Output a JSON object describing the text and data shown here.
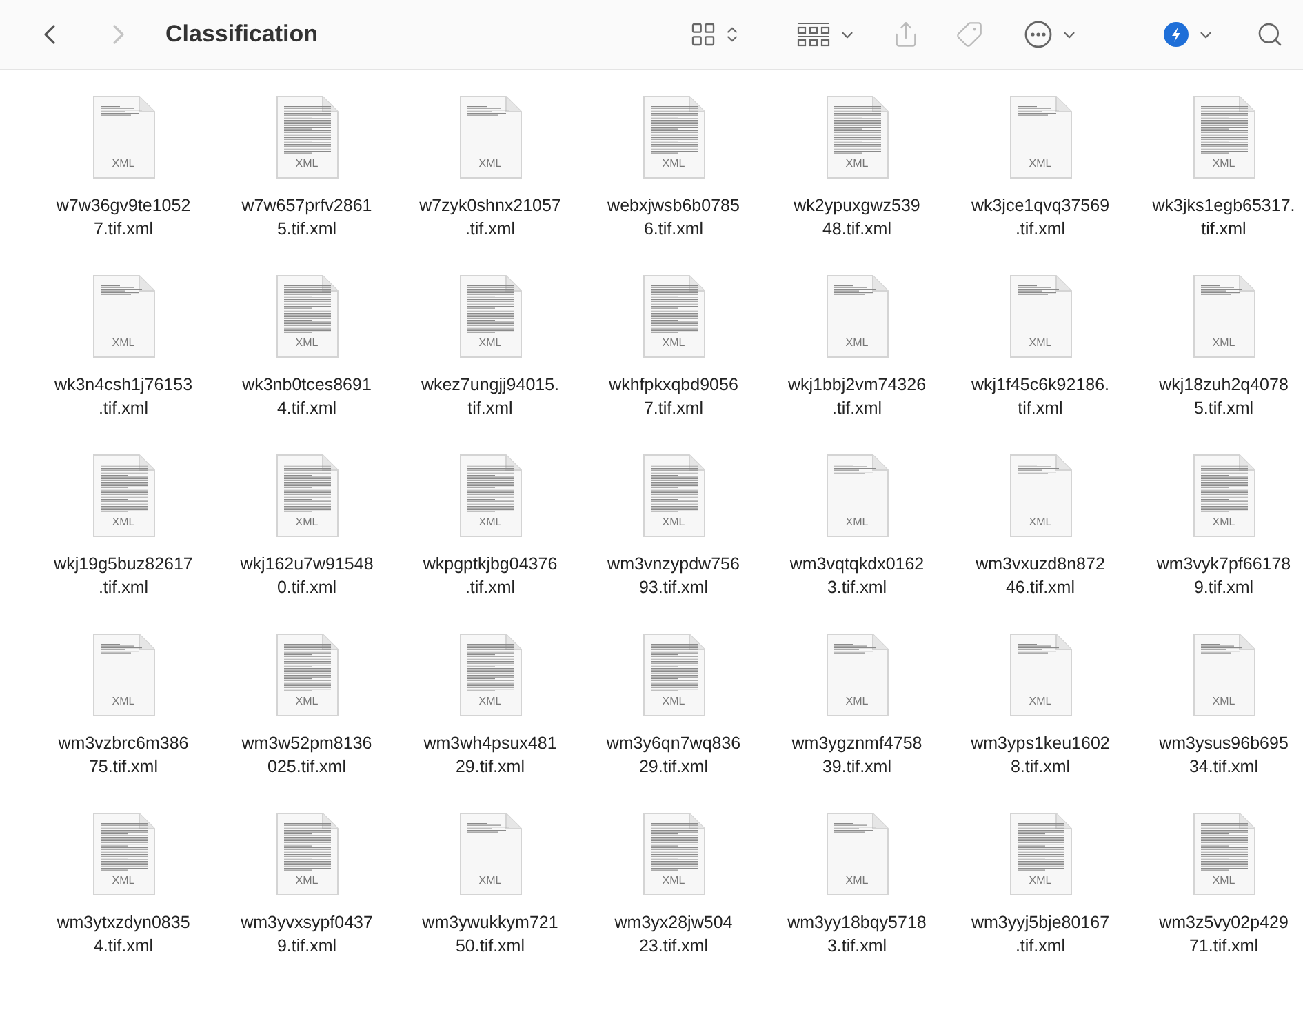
{
  "toolbar": {
    "title": "Classification",
    "navigation": [
      {
        "kind": "back",
        "disabled": false
      },
      {
        "kind": "forward",
        "disabled": true
      }
    ]
  },
  "files": [
    {
      "name_lines": [
        "w7w36gv9te1052",
        "7.tif.xml"
      ],
      "badge": "XML",
      "kind": "sparse"
    },
    {
      "name_lines": [
        "w7w657prfv2861",
        "5.tif.xml"
      ],
      "badge": "XML",
      "kind": "dense"
    },
    {
      "name_lines": [
        "w7zyk0shnx21057",
        ".tif.xml"
      ],
      "badge": "XML",
      "kind": "sparse"
    },
    {
      "name_lines": [
        "webxjwsb6b0785",
        "6.tif.xml"
      ],
      "badge": "XML",
      "kind": "dense"
    },
    {
      "name_lines": [
        "wk2ypuxgwz539",
        "48.tif.xml"
      ],
      "badge": "XML",
      "kind": "dense"
    },
    {
      "name_lines": [
        "wk3jce1qvq37569",
        ".tif.xml"
      ],
      "badge": "XML",
      "kind": "sparse"
    },
    {
      "name_lines": [
        "wk3jks1egb65317.",
        "tif.xml"
      ],
      "badge": "XML",
      "kind": "dense"
    },
    {
      "name_lines": [
        "wk3n4csh1j76153",
        ".tif.xml"
      ],
      "badge": "XML",
      "kind": "sparse"
    },
    {
      "name_lines": [
        "wk3nb0tces8691",
        "4.tif.xml"
      ],
      "badge": "XML",
      "kind": "dense"
    },
    {
      "name_lines": [
        "wkez7ungjj94015.",
        "tif.xml"
      ],
      "badge": "XML",
      "kind": "dense"
    },
    {
      "name_lines": [
        "wkhfpkxqbd9056",
        "7.tif.xml"
      ],
      "badge": "XML",
      "kind": "dense"
    },
    {
      "name_lines": [
        "wkj1bbj2vm74326",
        ".tif.xml"
      ],
      "badge": "XML",
      "kind": "sparse"
    },
    {
      "name_lines": [
        "wkj1f45c6k92186.",
        "tif.xml"
      ],
      "badge": "XML",
      "kind": "sparse"
    },
    {
      "name_lines": [
        "wkj18zuh2q4078",
        "5.tif.xml"
      ],
      "badge": "XML",
      "kind": "sparse"
    },
    {
      "name_lines": [
        "wkj19g5buz82617",
        ".tif.xml"
      ],
      "badge": "XML",
      "kind": "dense"
    },
    {
      "name_lines": [
        "wkj162u7w91548",
        "0.tif.xml"
      ],
      "badge": "XML",
      "kind": "dense"
    },
    {
      "name_lines": [
        "wkpgptkjbg04376",
        ".tif.xml"
      ],
      "badge": "XML",
      "kind": "dense"
    },
    {
      "name_lines": [
        "wm3vnzypdw756",
        "93.tif.xml"
      ],
      "badge": "XML",
      "kind": "dense"
    },
    {
      "name_lines": [
        "wm3vqtqkdx0162",
        "3.tif.xml"
      ],
      "badge": "XML",
      "kind": "sparse"
    },
    {
      "name_lines": [
        "wm3vxuzd8n872",
        "46.tif.xml"
      ],
      "badge": "XML",
      "kind": "sparse"
    },
    {
      "name_lines": [
        "wm3vyk7pf66178",
        "9.tif.xml"
      ],
      "badge": "XML",
      "kind": "dense"
    },
    {
      "name_lines": [
        "wm3vzbrc6m386",
        "75.tif.xml"
      ],
      "badge": "XML",
      "kind": "sparse"
    },
    {
      "name_lines": [
        "wm3w52pm8136",
        "025.tif.xml"
      ],
      "badge": "XML",
      "kind": "dense"
    },
    {
      "name_lines": [
        "wm3wh4psux481",
        "29.tif.xml"
      ],
      "badge": "XML",
      "kind": "dense"
    },
    {
      "name_lines": [
        "wm3y6qn7wq836",
        "29.tif.xml"
      ],
      "badge": "XML",
      "kind": "dense"
    },
    {
      "name_lines": [
        "wm3ygznmf4758",
        "39.tif.xml"
      ],
      "badge": "XML",
      "kind": "sparse"
    },
    {
      "name_lines": [
        "wm3yps1keu1602",
        "8.tif.xml"
      ],
      "badge": "XML",
      "kind": "sparse"
    },
    {
      "name_lines": [
        "wm3ysus96b695",
        "34.tif.xml"
      ],
      "badge": "XML",
      "kind": "sparse"
    },
    {
      "name_lines": [
        "wm3ytxzdyn0835",
        "4.tif.xml"
      ],
      "badge": "XML",
      "kind": "dense"
    },
    {
      "name_lines": [
        "wm3yvxsypf0437",
        "9.tif.xml"
      ],
      "badge": "XML",
      "kind": "dense"
    },
    {
      "name_lines": [
        "wm3ywukkym721",
        "50.tif.xml"
      ],
      "badge": "XML",
      "kind": "sparse"
    },
    {
      "name_lines": [
        "wm3yx28jw504",
        "23.tif.xml"
      ],
      "badge": "XML",
      "kind": "dense"
    },
    {
      "name_lines": [
        "wm3yy18bqy5718",
        "3.tif.xml"
      ],
      "badge": "XML",
      "kind": "sparse"
    },
    {
      "name_lines": [
        "wm3yyj5bje80167",
        ".tif.xml"
      ],
      "badge": "XML",
      "kind": "dense"
    },
    {
      "name_lines": [
        "wm3z5vy02p429",
        "71.tif.xml"
      ],
      "badge": "XML",
      "kind": "dense"
    }
  ]
}
